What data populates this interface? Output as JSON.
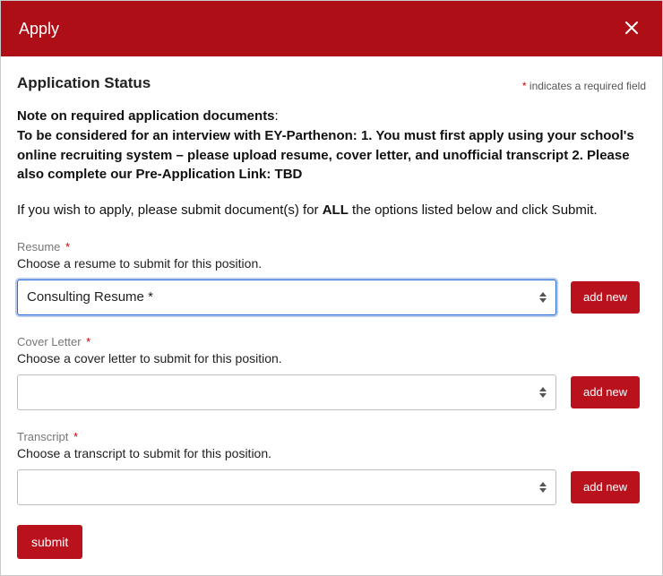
{
  "header": {
    "title": "Apply",
    "close_label": "Close"
  },
  "status": {
    "title": "Application Status",
    "required_note_prefix": "*",
    "required_note_text": " indicates a required field"
  },
  "note": {
    "intro": "Note on required application documents",
    "intro_punct": ":",
    "body": "To be considered for an interview with EY-Parthenon: 1. You must first apply using your school's online recruiting system – please upload resume, cover letter, and unofficial transcript 2. Please also complete our Pre-Application Link: TBD"
  },
  "all_line": {
    "pre": "If you wish to apply, please submit document(s) for ",
    "bold": "ALL",
    "post": " the options listed below and click Submit."
  },
  "fields": {
    "resume": {
      "label": "Resume",
      "required": "*",
      "help": "Choose a resume to submit for this position.",
      "selected": "Consulting Resume *",
      "add_new": "add new"
    },
    "cover_letter": {
      "label": "Cover Letter",
      "required": "*",
      "help": "Choose a cover letter to submit for this position.",
      "selected": "",
      "add_new": "add new"
    },
    "transcript": {
      "label": "Transcript",
      "required": "*",
      "help": "Choose a transcript to submit for this position.",
      "selected": "",
      "add_new": "add new"
    }
  },
  "actions": {
    "submit": "submit"
  }
}
